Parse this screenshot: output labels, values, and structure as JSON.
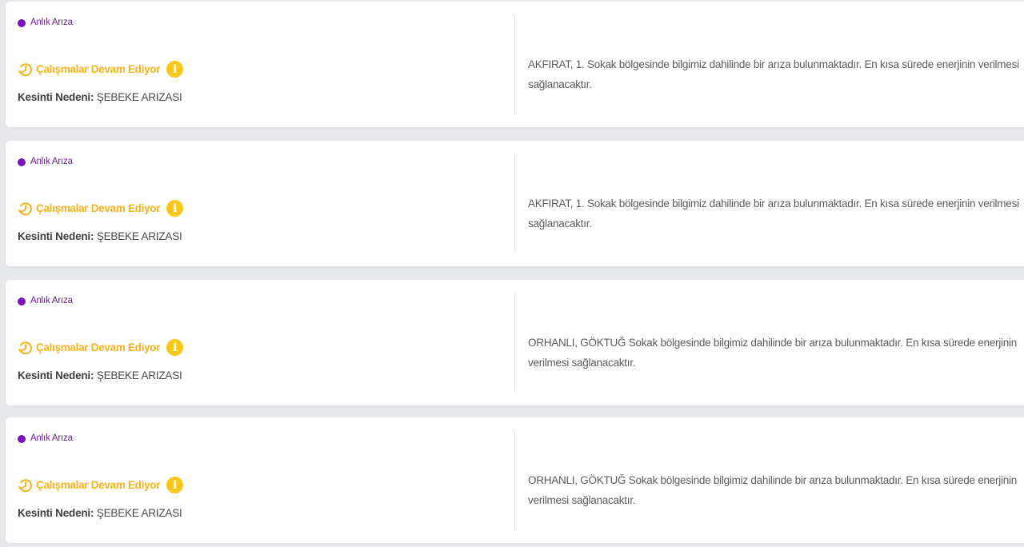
{
  "cards": [
    {
      "badge": "Anlık Arıza",
      "status": "Çalışmalar Devam Ediyor",
      "reason_label": "Kesinti Nedeni:",
      "reason_value": "ŞEBEKE ARIZASI",
      "description": "AKFIRAT, 1. Sokak bölgesinde bilgimiz dahilinde bir arıza bulunmaktadır. En kısa sürede enerjinin verilmesi sağlanacaktır."
    },
    {
      "badge": "Anlık Arıza",
      "status": "Çalışmalar Devam Ediyor",
      "reason_label": "Kesinti Nedeni:",
      "reason_value": "ŞEBEKE ARIZASI",
      "description": "AKFIRAT, 1. Sokak bölgesinde bilgimiz dahilinde bir arıza bulunmaktadır. En kısa sürede enerjinin verilmesi sağlanacaktır."
    },
    {
      "badge": "Anlık Arıza",
      "status": "Çalışmalar Devam Ediyor",
      "reason_label": "Kesinti Nedeni:",
      "reason_value": "ŞEBEKE ARIZASI",
      "description": "ORHANLI, GÖKTUĞ Sokak bölgesinde bilgimiz dahilinde bir arıza bulunmaktadır. En kısa sürede enerjinin verilmesi sağlanacaktır."
    },
    {
      "badge": "Anlık Arıza",
      "status": "Çalışmalar Devam Ediyor",
      "reason_label": "Kesinti Nedeni:",
      "reason_value": "ŞEBEKE ARIZASI",
      "description": "ORHANLI, GÖKTUĞ Sokak bölgesinde bilgimiz dahilinde bir arıza bulunmaktadır. En kısa sürede enerjinin verilmesi sağlanacaktır."
    }
  ],
  "icons": {
    "badge_dot": "dot-icon",
    "status_icon": "clock-rotate-icon",
    "info_icon": "info-icon",
    "info_glyph": "i"
  },
  "colors": {
    "badge_dot": "#7a14b8",
    "badge_text": "#6e1a9a",
    "status_text": "#f7b31a",
    "info_bg": "#f8c81b",
    "background": "#e8e9ec"
  }
}
